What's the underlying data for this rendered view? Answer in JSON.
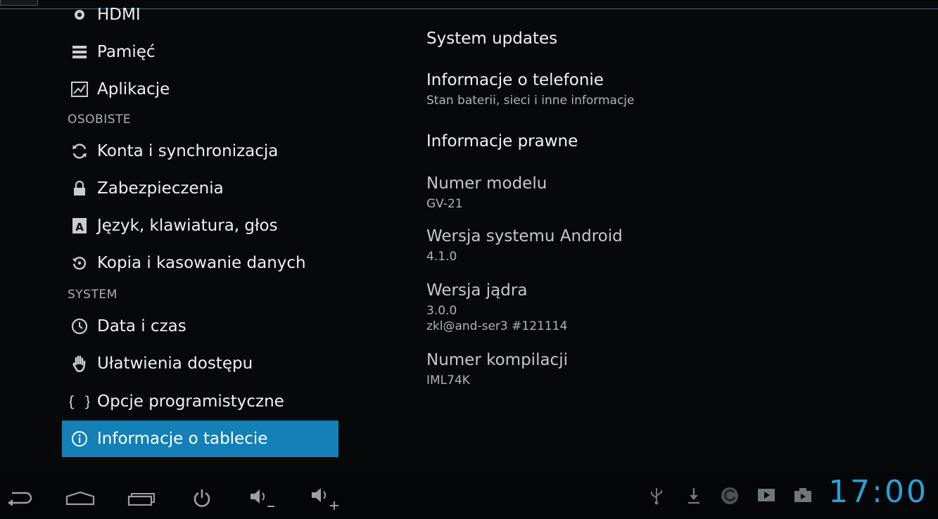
{
  "sidebar": {
    "items": [
      {
        "label": "HDMI",
        "icon": "hdmi-icon"
      },
      {
        "label": "Pamięć",
        "icon": "storage-icon"
      },
      {
        "label": "Aplikacje",
        "icon": "apps-icon"
      },
      {
        "label": "Konta i synchronizacja",
        "icon": "sync-icon"
      },
      {
        "label": "Zabezpieczenia",
        "icon": "lock-icon"
      },
      {
        "label": "Język, klawiatura, głos",
        "icon": "language-icon"
      },
      {
        "label": "Kopia i kasowanie danych",
        "icon": "backup-icon"
      },
      {
        "label": "Data i czas",
        "icon": "clock-icon"
      },
      {
        "label": "Ułatwienia dostępu",
        "icon": "hand-icon"
      },
      {
        "label": "Opcje programistyczne",
        "icon": "braces-icon"
      },
      {
        "label": "Informacje o tablecie",
        "icon": "info-icon"
      }
    ],
    "sections": {
      "personal": "OSOBISTE",
      "system": "SYSTEM"
    },
    "selected_color": "#1380b8"
  },
  "content": {
    "system_updates": "System updates",
    "phone_info": {
      "title": "Informacje o telefonie",
      "subtitle": "Stan baterii, sieci i inne informacje"
    },
    "legal_info": "Informacje prawne",
    "model": {
      "title": "Numer modelu",
      "value": "GV-21"
    },
    "android_version": {
      "title": "Wersja systemu Android",
      "value": "4.1.0"
    },
    "kernel": {
      "title": "Wersja jądra",
      "value_line1": "3.0.0",
      "value_line2": "zkl@and-ser3 #121114"
    },
    "build": {
      "title": "Numer kompilacji",
      "value": "IML74K"
    }
  },
  "navbar": {
    "buttons": [
      "back-icon",
      "home-icon",
      "recent-apps-icon",
      "power-icon",
      "volume-down-icon",
      "volume-up-icon"
    ],
    "status_icons": [
      "usb-icon",
      "download-icon",
      "sync-status-icon",
      "media-icon",
      "camera-icon"
    ],
    "clock": "17:00",
    "clock_color": "#2a9fd6"
  }
}
